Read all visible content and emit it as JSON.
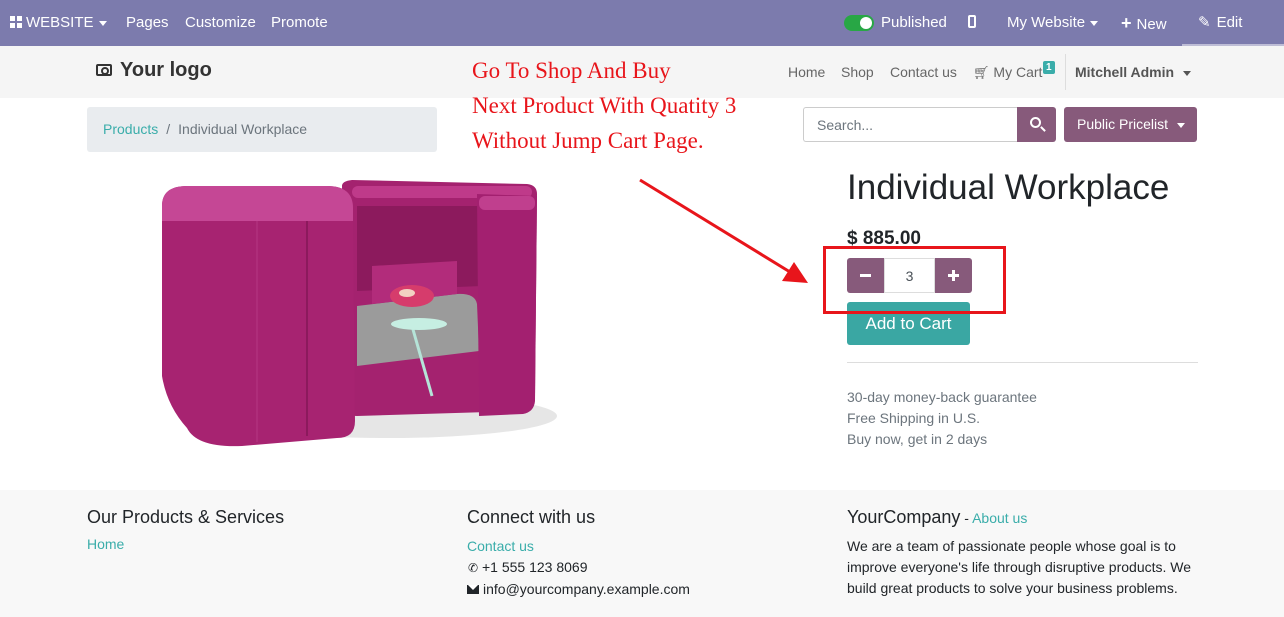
{
  "admin_bar": {
    "website_label": "WEBSITE",
    "menu": [
      "Pages",
      "Customize",
      "Promote"
    ],
    "published_label": "Published",
    "my_website_label": "My Website",
    "new_label": "New",
    "edit_label": "Edit",
    "publish_toggle_on": true
  },
  "header": {
    "logo_text": "Your logo",
    "nav": [
      "Home",
      "Shop",
      "Contact us"
    ],
    "cart_label": "My Cart",
    "cart_count": "1",
    "user_name": "Mitchell Admin"
  },
  "annotation": {
    "lines": [
      "Go To Shop And Buy",
      "Next Product With Quatity 3",
      "Without Jump Cart Page."
    ],
    "color": "#e8151b"
  },
  "breadcrumb": {
    "parent": "Products",
    "separator": "/",
    "current": "Individual Workplace"
  },
  "search": {
    "placeholder": "Search...",
    "value": ""
  },
  "pricelist_label": "Public Pricelist",
  "product": {
    "name": "Individual Workplace",
    "price": "$ 885.00",
    "quantity": "3",
    "add_to_cart_label": "Add to Cart",
    "guarantees": [
      "30-day money-back guarantee",
      "Free Shipping in U.S.",
      "Buy now, get in 2 days"
    ]
  },
  "footer": {
    "col1": {
      "title": "Our Products & Services",
      "links": [
        "Home"
      ]
    },
    "col2": {
      "title": "Connect with us",
      "contact_link": "Contact us",
      "phone": "+1 555 123 8069",
      "email": "info@yourcompany.example.com"
    },
    "col3": {
      "title": "YourCompany",
      "title_sep": " - ",
      "about_link": "About us",
      "text": "We are a team of passionate people whose goal is to improve everyone's life through disruptive products. We build great products to solve your business problems."
    }
  },
  "colors": {
    "admin_bar": "#7c7bad",
    "primary": "#875a7b",
    "accent": "#3aa7a3",
    "annotation": "#e8151b"
  }
}
